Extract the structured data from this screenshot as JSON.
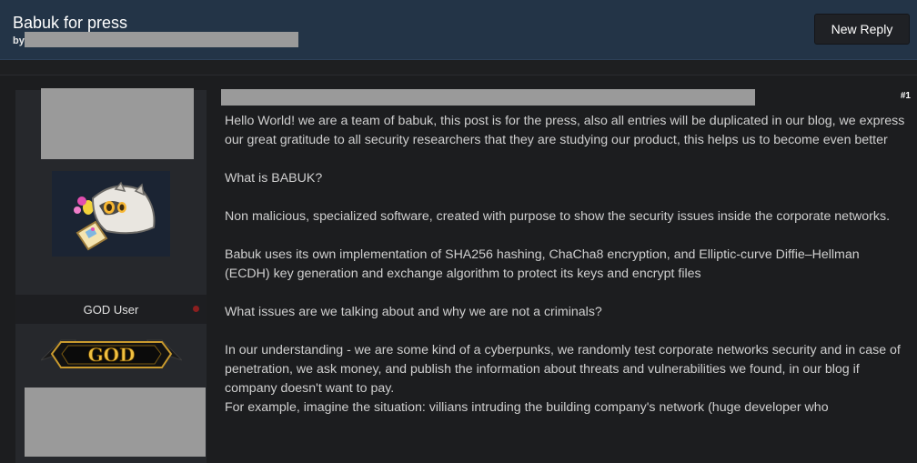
{
  "thread": {
    "title": "Babuk for press",
    "by_label": "by",
    "new_reply_label": "New Reply"
  },
  "user": {
    "user_title": "GOD User",
    "rank_badge_text": "GOD",
    "sticker_icon": "raccoon-sticker-icon",
    "status_color": "#8b1f1f"
  },
  "post": {
    "number": "#1",
    "paragraphs": [
      "Hello World! we are a team of babuk, this post is for the press, also all entries will be duplicated in our blog, we express our great gratitude to all security researchers that they are studying our product, this helps us to become even better",
      "What is BABUK?",
      "Non malicious, specialized software, created with purpose to show the security issues inside the corporate networks.",
      "Babuk uses its own implementation of SHA256 hashing, ChaCha8 encryption, and Elliptic-curve Diffie–Hellman (ECDH) key generation and exchange algorithm to protect its keys and encrypt files",
      "What issues are we talking about and why we are not a criminals?",
      "In our understanding - we are some kind of a cyberpunks, we randomly test corporate networks security and in case of penetration, we ask money, and publish the information about threats and vulnerabilities we found, in our blog if company doesn't want to pay.",
      "For example, imagine the situation: villians intruding the building company's network (huge developer who"
    ]
  },
  "colors": {
    "header_bg": "#233447",
    "page_bg": "#1e1f21",
    "panel_bg": "#26282c",
    "redaction": "#9a9a9a"
  }
}
